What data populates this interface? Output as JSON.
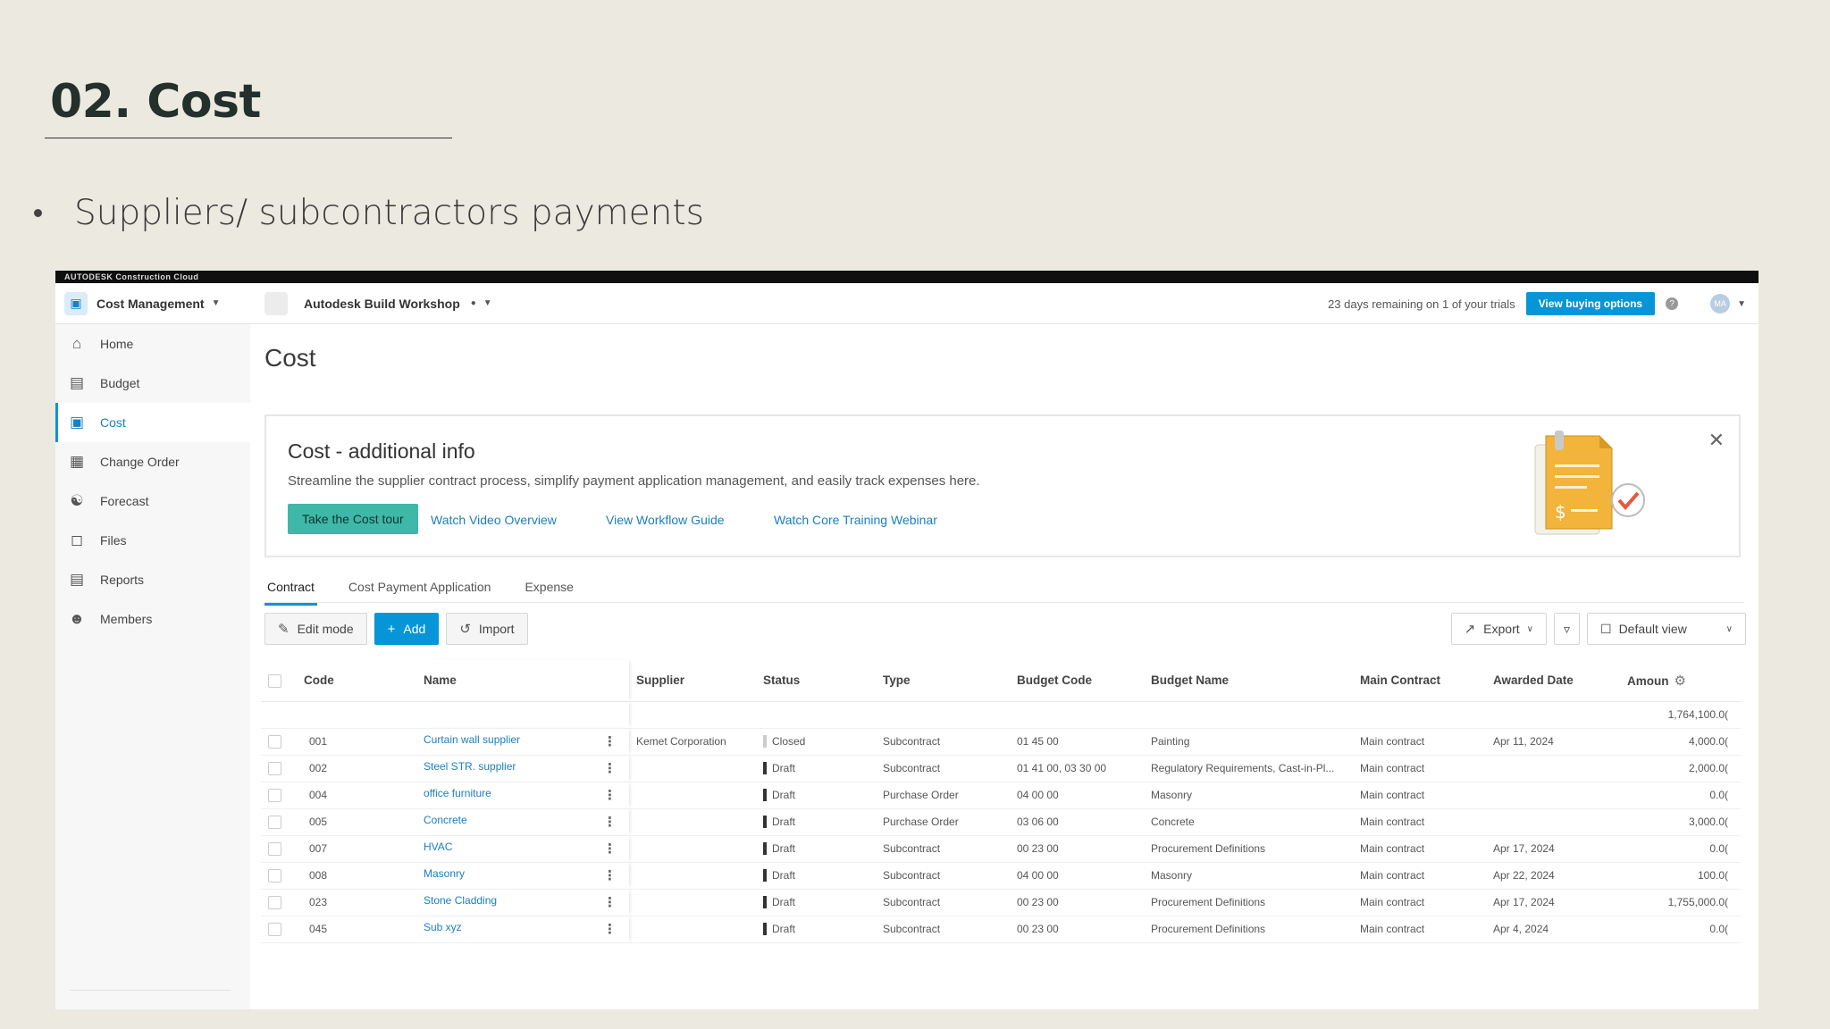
{
  "slide": {
    "title": "02. Cost",
    "bullet": "Suppliers/ subcontractors payments"
  },
  "app": {
    "brand": "AUTODESK Construction Cloud",
    "module": "Cost Management",
    "project": "Autodesk Build Workshop",
    "trial_text": "23 days remaining on 1 of your trials",
    "buy_label": "View buying options",
    "avatar_initials": "MA",
    "accent_color": "#0696d7"
  },
  "sidebar": {
    "items": [
      {
        "label": "Home",
        "icon": "home-icon"
      },
      {
        "label": "Budget",
        "icon": "budget-icon"
      },
      {
        "label": "Cost",
        "icon": "cost-icon"
      },
      {
        "label": "Change Order",
        "icon": "change-order-icon"
      },
      {
        "label": "Forecast",
        "icon": "binoculars-icon"
      },
      {
        "label": "Files",
        "icon": "file-icon"
      },
      {
        "label": "Reports",
        "icon": "report-icon"
      },
      {
        "label": "Members",
        "icon": "members-icon"
      }
    ],
    "active": "Cost"
  },
  "main": {
    "page_title": "Cost",
    "info": {
      "title": "Cost - additional info",
      "text": "Streamline the supplier contract process, simplify payment application management, and easily track expenses here.",
      "tour_label": "Take the Cost tour",
      "links": [
        "Watch Video Overview",
        "View Workflow Guide",
        "Watch Core Training Webinar"
      ]
    },
    "tabs": [
      "Contract",
      "Cost Payment Application",
      "Expense"
    ],
    "active_tab": "Contract",
    "toolbar": {
      "edit_label": "Edit mode",
      "add_label": "Add",
      "import_label": "Import",
      "export_label": "Export",
      "view_label": "Default view"
    },
    "table": {
      "headers": [
        "Code",
        "Name",
        "Supplier",
        "Status",
        "Type",
        "Budget Code",
        "Budget Name",
        "Main Contract",
        "Awarded Date",
        "Amoun"
      ],
      "total": "1,764,100.0(",
      "rows": [
        {
          "code": "001",
          "name": "Curtain wall supplier",
          "supplier": "Kemet Corporation",
          "status": "Closed",
          "type": "Subcontract",
          "budget_code": "01 45 00",
          "budget_name": "Painting",
          "main_contract": "Main contract",
          "awarded": "Apr 11, 2024",
          "amount": "4,000.0("
        },
        {
          "code": "002",
          "name": "Steel STR. supplier",
          "supplier": "",
          "status": "Draft",
          "type": "Subcontract",
          "budget_code": "01 41 00, 03 30 00",
          "budget_name": "Regulatory Requirements, Cast-in-Pl...",
          "main_contract": "Main contract",
          "awarded": "",
          "amount": "2,000.0("
        },
        {
          "code": "004",
          "name": "office furniture",
          "supplier": "",
          "status": "Draft",
          "type": "Purchase Order",
          "budget_code": "04 00 00",
          "budget_name": "Masonry",
          "main_contract": "Main contract",
          "awarded": "",
          "amount": "0.0("
        },
        {
          "code": "005",
          "name": "Concrete",
          "supplier": "",
          "status": "Draft",
          "type": "Purchase Order",
          "budget_code": "03 06 00",
          "budget_name": "Concrete",
          "main_contract": "Main contract",
          "awarded": "",
          "amount": "3,000.0("
        },
        {
          "code": "007",
          "name": "HVAC",
          "supplier": "",
          "status": "Draft",
          "type": "Subcontract",
          "budget_code": "00 23 00",
          "budget_name": "Procurement Definitions",
          "main_contract": "Main contract",
          "awarded": "Apr 17, 2024",
          "amount": "0.0("
        },
        {
          "code": "008",
          "name": "Masonry",
          "supplier": "",
          "status": "Draft",
          "type": "Subcontract",
          "budget_code": "04 00 00",
          "budget_name": "Masonry",
          "main_contract": "Main contract",
          "awarded": "Apr 22, 2024",
          "amount": "100.0("
        },
        {
          "code": "023",
          "name": "Stone Cladding",
          "supplier": "",
          "status": "Draft",
          "type": "Subcontract",
          "budget_code": "00 23 00",
          "budget_name": "Procurement Definitions",
          "main_contract": "Main contract",
          "awarded": "Apr 17, 2024",
          "amount": "1,755,000.0("
        },
        {
          "code": "045",
          "name": "Sub xyz",
          "supplier": "",
          "status": "Draft",
          "type": "Subcontract",
          "budget_code": "00 23 00",
          "budget_name": "Procurement Definitions",
          "main_contract": "Main contract",
          "awarded": "Apr 4, 2024",
          "amount": "0.0("
        }
      ]
    }
  }
}
